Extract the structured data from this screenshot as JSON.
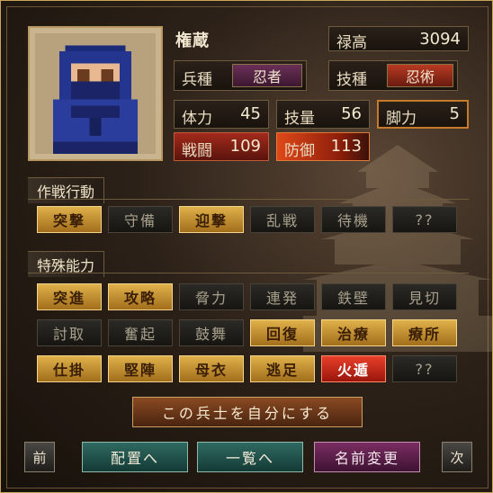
{
  "unit": {
    "name": "権蔵",
    "stipend_label": "禄高",
    "stipend_value": "3094",
    "troop_label": "兵種",
    "troop_value": "忍者",
    "skill_label": "技種",
    "skill_value": "忍術",
    "stats": [
      {
        "label": "体力",
        "value": "45"
      },
      {
        "label": "技量",
        "value": "56"
      },
      {
        "label": "脚力",
        "value": "5"
      },
      {
        "label": "戦闘",
        "value": "109"
      },
      {
        "label": "防御",
        "value": "113"
      }
    ]
  },
  "tactics": {
    "title": "作戦行動",
    "items": [
      {
        "label": "突撃",
        "state": "on"
      },
      {
        "label": "守備",
        "state": "off"
      },
      {
        "label": "迎撃",
        "state": "on"
      },
      {
        "label": "乱戦",
        "state": "off"
      },
      {
        "label": "待機",
        "state": "off"
      },
      {
        "label": "??",
        "state": "off"
      }
    ]
  },
  "abilities": {
    "title": "特殊能力",
    "items": [
      {
        "label": "突進",
        "state": "on"
      },
      {
        "label": "攻略",
        "state": "on"
      },
      {
        "label": "脅力",
        "state": "off"
      },
      {
        "label": "連発",
        "state": "off"
      },
      {
        "label": "鉄壁",
        "state": "off"
      },
      {
        "label": "見切",
        "state": "off"
      },
      {
        "label": "討取",
        "state": "off"
      },
      {
        "label": "奮起",
        "state": "off"
      },
      {
        "label": "鼓舞",
        "state": "off"
      },
      {
        "label": "回復",
        "state": "on"
      },
      {
        "label": "治療",
        "state": "on"
      },
      {
        "label": "療所",
        "state": "on"
      },
      {
        "label": "仕掛",
        "state": "on"
      },
      {
        "label": "堅陣",
        "state": "on"
      },
      {
        "label": "母衣",
        "state": "on"
      },
      {
        "label": "逃足",
        "state": "on"
      },
      {
        "label": "火遁",
        "state": "fire"
      },
      {
        "label": "??",
        "state": "off"
      }
    ]
  },
  "actions": {
    "make_own": "この兵士を自分にする",
    "prev": "前",
    "deploy": "配置へ",
    "list": "一覧へ",
    "rename": "名前変更",
    "next": "次"
  },
  "colors": {
    "on_gold": "#dfb14a",
    "fire_red": "#e8402a",
    "off_dark": "#2b2a26",
    "teal": "#2f6a62",
    "magenta": "#7a2d62"
  },
  "icons": {
    "portrait": "ninja-portrait-icon",
    "background": "castle-icon"
  }
}
